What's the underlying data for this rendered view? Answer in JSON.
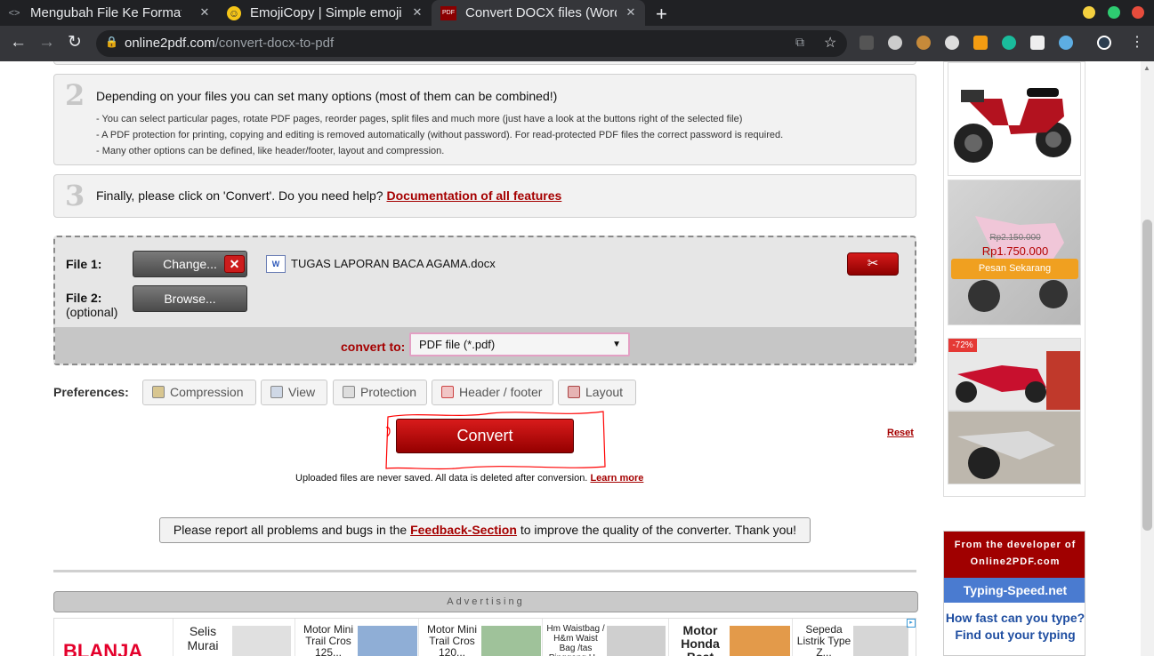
{
  "browser": {
    "tabs": [
      {
        "title": "Mengubah File Ke Format",
        "icon": "code-icon",
        "close": "✕"
      },
      {
        "title": "EmojiCopy | Simple emoji",
        "icon": "emoji-icon",
        "close": "✕"
      },
      {
        "title": "Convert DOCX files (Word",
        "icon": "pdf-icon",
        "icon_text": "PDF",
        "close": "✕"
      }
    ],
    "new_tab": "+",
    "url_domain": "online2pdf.com",
    "url_path": "/convert-docx-to-pdf"
  },
  "steps": {
    "step2": {
      "num": "2",
      "heading": "Depending on your files you can set many options (most of them can be combined!)",
      "bullets": [
        "- You can select particular pages, rotate PDF pages, reorder pages, split files and much more (just have a look at the buttons right of the selected file)",
        "- A PDF protection for printing, copying and editing is removed automatically (without password). For read-protected PDF files the correct password is required.",
        "- Many other options can be defined, like header/footer, layout and compression."
      ]
    },
    "step3": {
      "num": "3",
      "heading": "Finally, please click on 'Convert'. Do you need help?",
      "link": "Documentation of all features"
    }
  },
  "files": {
    "file1_label": "File 1:",
    "change_btn": "Change...",
    "delete_icon": "✕",
    "doc_icon_text": "W",
    "file1_name": "TUGAS LAPORAN BACA AGAMA.docx",
    "cut_icon": "✂",
    "file2_label": "File 2:",
    "file2_optional": "(optional)",
    "browse_btn": "Browse...",
    "convert_to_label": "convert to:",
    "convert_to_value": "PDF file (*.pdf)",
    "select_arrow": "▼"
  },
  "preferences": {
    "label": "Preferences:",
    "buttons": [
      "Compression",
      "View",
      "Protection",
      "Header / footer",
      "Layout"
    ]
  },
  "convert_btn": "Convert",
  "reset": "Reset",
  "uploaded_note": "Uploaded files are never saved. All data is deleted after conversion.",
  "learn_more": "Learn more",
  "feedback": {
    "before": "Please report all problems and bugs in the",
    "link": "Feedback-Section",
    "after": "to improve the quality of the converter. Thank you!"
  },
  "advertising": "Advertising",
  "ads": [
    {
      "text": "BLANJA"
    },
    {
      "text": "Selis Murai"
    },
    {
      "text": "Motor Mini Trail Cros 125..."
    },
    {
      "text": "Motor Mini Trail Cros 120..."
    },
    {
      "text": "Hm Waistbag / H&m Waist Bag /tas Pinggang H..."
    },
    {
      "text": "Motor Honda Beat"
    },
    {
      "text": "Sepeda Listrik Type Z..."
    }
  ],
  "sidebar": {
    "old_price": "Rp2.150.000",
    "new_price": "Rp1.750.000",
    "pesan": "Pesan Sekarang",
    "discount": "-72%"
  },
  "developer": {
    "line1": "From the developer of",
    "line2": "Online2PDF.com",
    "title": "Typing-Speed.net",
    "question": "How fast can you type?",
    "cta": "Find out your typing"
  },
  "colors": {
    "accent_red": "#a50000",
    "link_blue": "#1f4ea1"
  }
}
